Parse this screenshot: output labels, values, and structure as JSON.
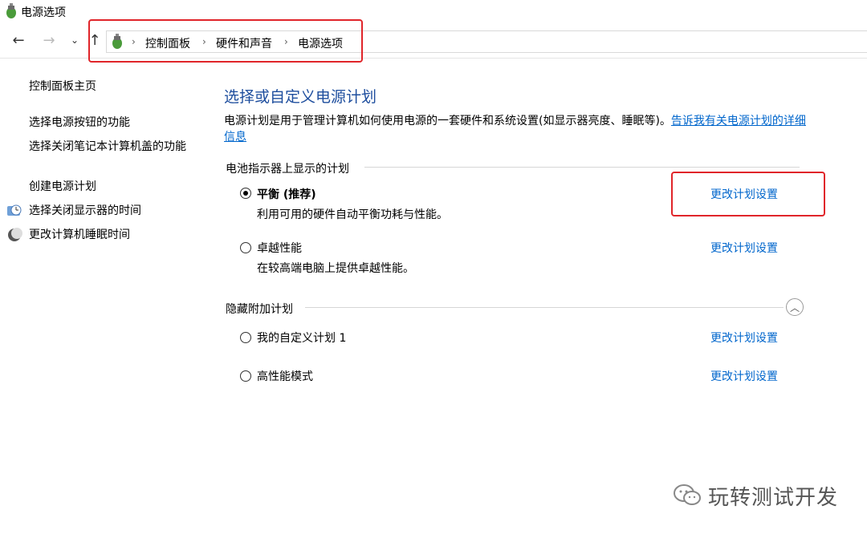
{
  "window": {
    "title": "电源选项"
  },
  "nav": {
    "back_icon": "arrow-left-icon",
    "forward_icon": "arrow-right-icon",
    "recent_icon": "chevron-down-icon",
    "up_icon": "arrow-up-icon"
  },
  "breadcrumb": [
    "控制面板",
    "硬件和声音",
    "电源选项"
  ],
  "left": {
    "home": "控制面板主页",
    "links": [
      "选择电源按钮的功能",
      "选择关闭笔记本计算机盖的功能",
      "创建电源计划",
      "选择关闭显示器的时间",
      "更改计算机睡眠时间"
    ]
  },
  "main": {
    "title": "选择或自定义电源计划",
    "desc_text": "电源计划是用于管理计算机如何使用电源的一套硬件和系统设置(如显示器亮度、睡眠等)。",
    "desc_link": "告诉我有关电源计划的详细信息",
    "section1": "电池指示器上显示的计划",
    "section2": "隐藏附加计划",
    "plans": [
      {
        "name": "平衡 (推荐)",
        "desc": "利用可用的硬件自动平衡功耗与性能。",
        "checked": true,
        "link": "更改计划设置"
      },
      {
        "name": "卓越性能",
        "desc": "在较高端电脑上提供卓越性能。",
        "checked": false,
        "link": "更改计划设置"
      },
      {
        "name": "我的自定义计划 1",
        "desc": "",
        "checked": false,
        "link": "更改计划设置"
      },
      {
        "name": "高性能模式",
        "desc": "",
        "checked": false,
        "link": "更改计划设置"
      }
    ]
  },
  "watermark": {
    "text": "玩转测试开发"
  },
  "colors": {
    "title_blue": "#1e4e9e",
    "link_blue": "#0066cc",
    "highlight_red": "#e0252a"
  }
}
